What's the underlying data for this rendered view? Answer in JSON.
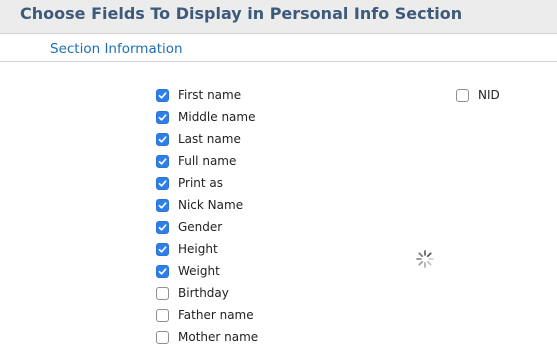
{
  "header": {
    "title": "Choose Fields To Display in Personal Info Section"
  },
  "section": {
    "title": "Section Information"
  },
  "fields": [
    {
      "label": "First name",
      "checked": true
    },
    {
      "label": "Middle name",
      "checked": true
    },
    {
      "label": "Last name",
      "checked": true
    },
    {
      "label": "Full name",
      "checked": true
    },
    {
      "label": "Print as",
      "checked": true
    },
    {
      "label": "Nick Name",
      "checked": true
    },
    {
      "label": "Gender",
      "checked": true
    },
    {
      "label": "Height",
      "checked": true
    },
    {
      "label": "Weight",
      "checked": true
    },
    {
      "label": "Birthday",
      "checked": false
    },
    {
      "label": "Father name",
      "checked": false
    },
    {
      "label": "Mother name",
      "checked": false
    }
  ],
  "right_fields": [
    {
      "label": "NID",
      "checked": false
    }
  ],
  "colors": {
    "accent": "#2f7fe8",
    "title": "#3d5a7a",
    "section": "#1f6fb2"
  },
  "icons": {
    "loading": "loading-spinner-icon"
  }
}
